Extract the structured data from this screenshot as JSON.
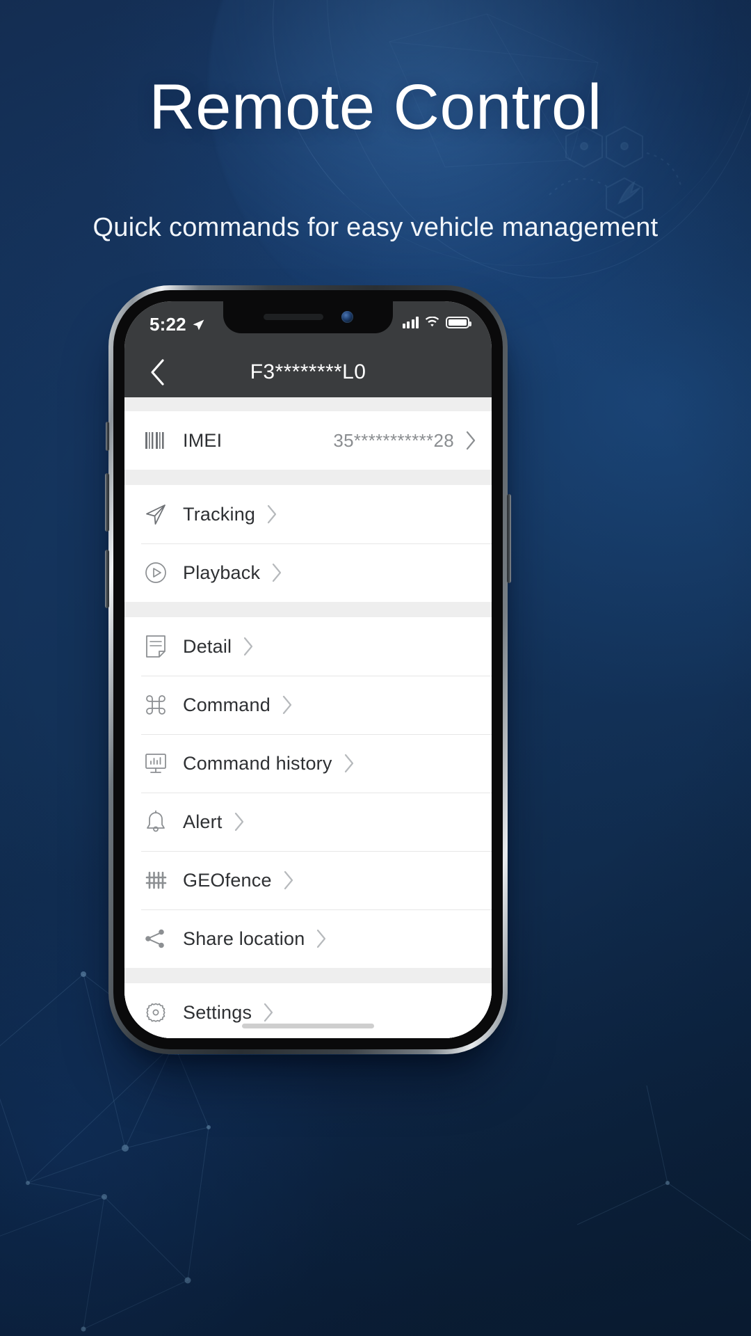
{
  "hero": {
    "title": "Remote Control",
    "subtitle": "Quick commands for easy vehicle management"
  },
  "colors": {
    "background_top": "#1b3c6b",
    "background_bottom": "#0b2038",
    "nav_bar": "#3a3c3e",
    "list_background": "#eeeeee",
    "row_background": "#ffffff",
    "label_text": "#2e3033",
    "value_text": "#8a8d90"
  },
  "phone": {
    "status_bar": {
      "time": "5:22",
      "location_icon": "location-arrow-icon",
      "signal_icon": "cellular-signal-icon",
      "wifi_icon": "wifi-icon",
      "battery_icon": "battery-full-icon"
    },
    "nav": {
      "back_icon": "chevron-left-icon",
      "title": "F3********L0"
    },
    "groups": [
      {
        "rows": [
          {
            "icon": "barcode-icon",
            "label": "IMEI",
            "value": "35***********28",
            "chevron": "chevron-right-icon"
          }
        ]
      },
      {
        "rows": [
          {
            "icon": "navigation-arrow-icon",
            "label": "Tracking",
            "value": "",
            "chevron": "chevron-right-icon"
          },
          {
            "icon": "play-circle-icon",
            "label": "Playback",
            "value": "",
            "chevron": "chevron-right-icon"
          }
        ]
      },
      {
        "rows": [
          {
            "icon": "document-icon",
            "label": "Detail",
            "value": "",
            "chevron": "chevron-right-icon"
          },
          {
            "icon": "command-icon",
            "label": "Command",
            "value": "",
            "chevron": "chevron-right-icon"
          },
          {
            "icon": "monitor-chart-icon",
            "label": "Command history",
            "value": "",
            "chevron": "chevron-right-icon"
          },
          {
            "icon": "bell-icon",
            "label": "Alert",
            "value": "",
            "chevron": "chevron-right-icon"
          },
          {
            "icon": "fence-grid-icon",
            "label": "GEOfence",
            "value": "",
            "chevron": "chevron-right-icon"
          },
          {
            "icon": "share-icon",
            "label": "Share location",
            "value": "",
            "chevron": "chevron-right-icon"
          }
        ]
      },
      {
        "rows": [
          {
            "icon": "gear-icon",
            "label": "Settings",
            "value": "",
            "chevron": "chevron-right-icon"
          }
        ]
      }
    ]
  }
}
